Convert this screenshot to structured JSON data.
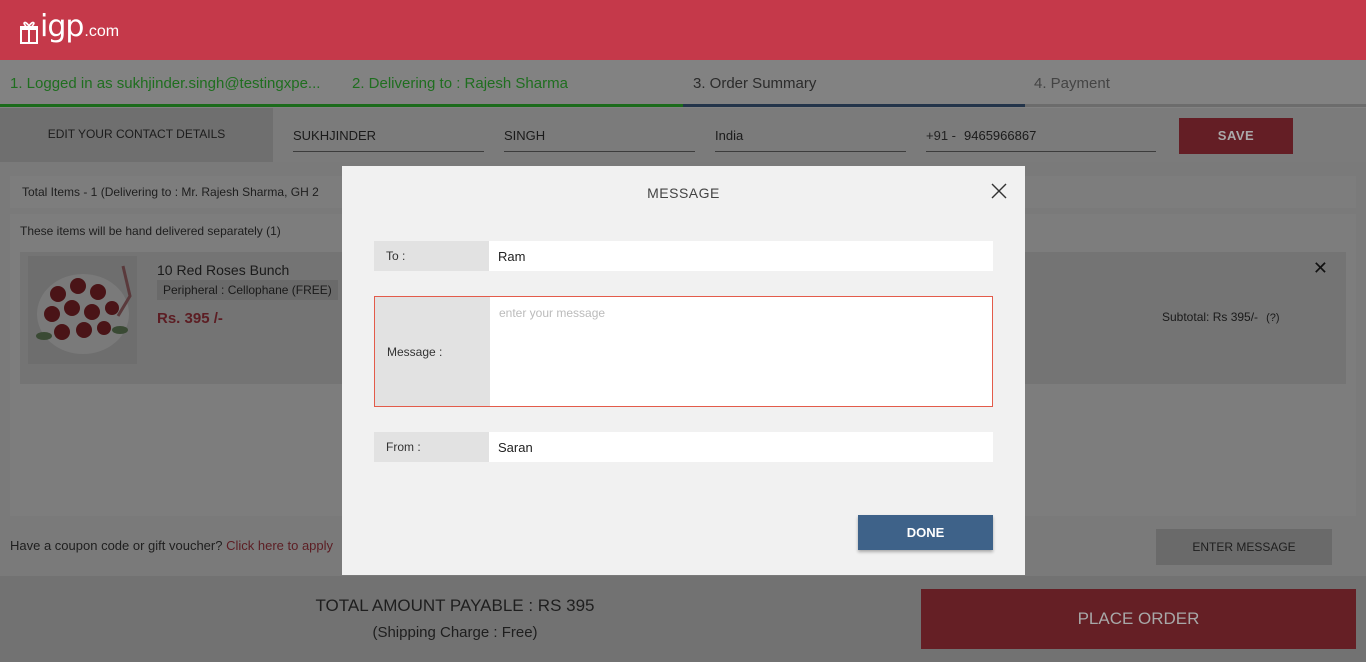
{
  "header": {
    "brand": "igp",
    "tld": ".com"
  },
  "steps": [
    {
      "label": "1. Logged in as sukhjinder.singh@testingxpe..."
    },
    {
      "label": "2. Delivering to : Rajesh Sharma"
    },
    {
      "label": "3. Order Summary"
    },
    {
      "label": "4. Payment"
    }
  ],
  "contact": {
    "label": "EDIT YOUR CONTACT DETAILS",
    "first_name": "SUKHJINDER",
    "last_name": "SINGH",
    "country": "India",
    "phone_code": "+91 -",
    "phone": "9465966867",
    "save_label": "SAVE"
  },
  "summary": {
    "total_items": "Total Items - 1 (Delivering to : Mr. Rajesh Sharma, GH 2"
  },
  "items": {
    "heading": "These items will be hand delivered separately (1)",
    "list": [
      {
        "name": "10 Red Roses Bunch",
        "peripheral": "Peripheral : Cellophane (FREE)",
        "price": "Rs. 395 /-",
        "subtotal": "Subtotal: Rs 395/-",
        "help": "(?)",
        "remove": "✕"
      }
    ]
  },
  "coupon": {
    "text": "Have a coupon code or gift voucher?",
    "link": "Click here to apply"
  },
  "enter_message_label": "ENTER MESSAGE",
  "footer": {
    "total": "TOTAL AMOUNT PAYABLE : RS 395",
    "shipping": "(Shipping Charge : Free)",
    "place_order": "PLACE ORDER"
  },
  "modal": {
    "title": "MESSAGE",
    "to_label": "To :",
    "to_value": "Ram",
    "message_label": "Message :",
    "message_placeholder": "enter your message",
    "from_label": "From :",
    "from_value": "Saran",
    "done_label": "DONE"
  },
  "colors": {
    "brand": "#c5394a",
    "step_done": "#1b6b1b",
    "step_active": "#23344a",
    "done_button": "#3e6289",
    "message_border": "#e35b4a"
  }
}
